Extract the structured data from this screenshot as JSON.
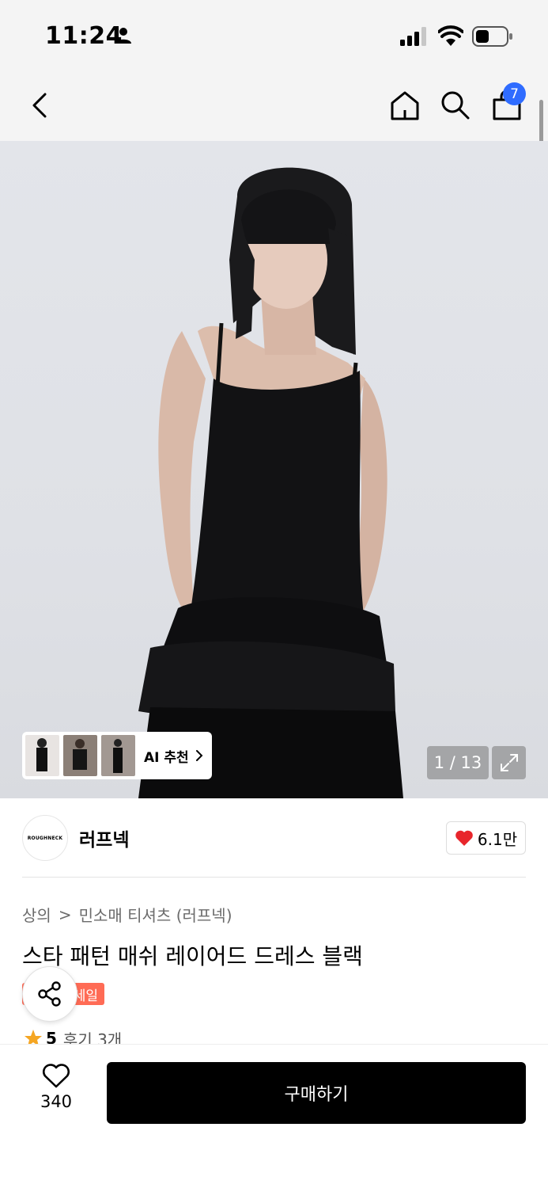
{
  "status_bar": {
    "time": "11:24",
    "icons": [
      "person-icon",
      "signal-icon",
      "wifi-icon",
      "battery-icon"
    ]
  },
  "nav": {
    "icons": [
      "back-chevron-icon",
      "home-icon",
      "search-icon",
      "cart-icon"
    ],
    "cart_count": "7"
  },
  "gallery": {
    "ai_label": "AI 추천",
    "page_counter": "1 / 13",
    "expand_icon": "expand-icon"
  },
  "brand": {
    "logo_text": "ROUGHNECK",
    "name": "러프넥",
    "like_count": "6.1만"
  },
  "product": {
    "breadcrumb": [
      "상의",
      "민소매 티셔츠 (러프넥)"
    ],
    "breadcrumb_separator": ">",
    "title": "스타 패턴 매쉬 레이어드 드레스 블랙",
    "sale_badge": "세일",
    "rating": "5",
    "review_text": "후기 3개"
  },
  "bottom_bar": {
    "wish_count": "340",
    "buy_label": "구매하기"
  },
  "colors": {
    "accent_blue": "#2f6cff",
    "sale_red": "#ff6b55",
    "heart_red": "#e8262c",
    "star_orange": "#f5a623"
  }
}
